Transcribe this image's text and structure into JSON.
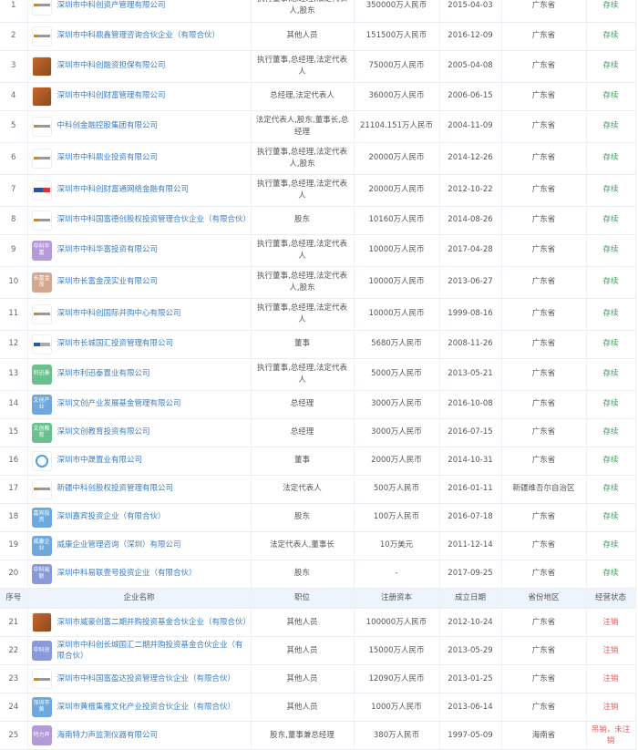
{
  "header": {
    "no": "序号",
    "name": "企业名称",
    "position": "职位",
    "capital": "注册资本",
    "date": "成立日期",
    "province": "省份地区",
    "status": "经营状态"
  },
  "colors": {
    "link": "#3b7dc4",
    "active": "#3c9a5f",
    "cancelled": "#e06060",
    "header_bg": "#eef4fb"
  },
  "table1": [
    {
      "no": "1",
      "logo": "strip",
      "name": "深圳市中科创资产管理有限公司",
      "position": "执行董事,总经理,法定代表人,股东",
      "capital": "350000万人民币",
      "date": "2015-04-03",
      "province": "广东省",
      "status": "存续"
    },
    {
      "no": "2",
      "logo": "strip",
      "name": "深圳市中科鼎鑫管理咨询合伙企业（有限合伙）",
      "position": "其他人员",
      "capital": "151500万人民币",
      "date": "2016-12-09",
      "province": "广东省",
      "status": "存续"
    },
    {
      "no": "3",
      "logo": "orange",
      "name": "深圳市中科创融资担保有限公司",
      "position": "执行董事,总经理,法定代表人",
      "capital": "75000万人民币",
      "date": "2005-04-08",
      "province": "广东省",
      "status": "存续"
    },
    {
      "no": "4",
      "logo": "orange",
      "name": "深圳市中科创财富管理有限公司",
      "position": "总经理,法定代表人",
      "capital": "36000万人民币",
      "date": "2006-06-15",
      "province": "广东省",
      "status": "存续"
    },
    {
      "no": "5",
      "logo": "strip",
      "name": "中科创金融控股集团有限公司",
      "position": "法定代表人,股东,董事长,总经理",
      "capital": "21104.151万人民币",
      "date": "2004-11-09",
      "province": "广东省",
      "status": "存续"
    },
    {
      "no": "6",
      "logo": "strip",
      "name": "深圳市中科鼎业投资有限公司",
      "position": "执行董事,总经理,法定代表人,股东",
      "capital": "20000万人民币",
      "date": "2014-12-26",
      "province": "广东省",
      "status": "存续"
    },
    {
      "no": "7",
      "logo": "flag",
      "name": "深圳市中科创财富通网络金融有限公司",
      "position": "执行董事,总经理,法定代表人",
      "capital": "20000万人民币",
      "date": "2012-10-22",
      "province": "广东省",
      "status": "存续"
    },
    {
      "no": "8",
      "logo": "strip",
      "name": "深圳市中科国富德创股权投资管理合伙企业（有限合伙）",
      "position": "股东",
      "capital": "10160万人民币",
      "date": "2014-08-26",
      "province": "广东省",
      "status": "存续"
    },
    {
      "no": "9",
      "logo": "text",
      "logo_text": "中科华富",
      "logo_color": "#b49ad8",
      "name": "深圳市中科华富投资有限公司",
      "position": "执行董事,总经理,法定代表人",
      "capital": "10000万人民币",
      "date": "2017-04-28",
      "province": "广东省",
      "status": "存续"
    },
    {
      "no": "10",
      "logo": "text",
      "logo_text": "长富金茂",
      "logo_color": "#d4a890",
      "name": "深圳市长富金茂实业有限公司",
      "position": "执行董事,总经理,法定代表人,股东",
      "capital": "10000万人民币",
      "date": "2013-06-27",
      "province": "广东省",
      "status": "存续"
    },
    {
      "no": "11",
      "logo": "strip",
      "name": "深圳市中科创国际并购中心有限公司",
      "position": "执行董事,总经理,法定代表人",
      "capital": "10000万人民币",
      "date": "1999-08-16",
      "province": "广东省",
      "status": "存续"
    },
    {
      "no": "12",
      "logo": "mini",
      "name": "深圳市长城国汇投资管理有限公司",
      "position": "董事",
      "capital": "5680万人民币",
      "date": "2008-11-26",
      "province": "广东省",
      "status": "存续"
    },
    {
      "no": "13",
      "logo": "text",
      "logo_text": "利迅泰",
      "logo_color": "#6cc08e",
      "name": "深圳市利迅泰置业有限公司",
      "position": "执行董事,总经理,法定代表人",
      "capital": "5000万人民币",
      "date": "2013-05-21",
      "province": "广东省",
      "status": "存续"
    },
    {
      "no": "14",
      "logo": "text",
      "logo_text": "文创产业",
      "logo_color": "#6fa8dc",
      "name": "深圳文创产业发展基金管理有限公司",
      "position": "总经理",
      "capital": "3000万人民币",
      "date": "2016-10-08",
      "province": "广东省",
      "status": "存续"
    },
    {
      "no": "15",
      "logo": "text",
      "logo_text": "文创教育",
      "logo_color": "#6cc08e",
      "name": "深圳文创教育投资有限公司",
      "position": "总经理",
      "capital": "3000万人民币",
      "date": "2016-07-15",
      "province": "广东省",
      "status": "存续"
    },
    {
      "no": "16",
      "logo": "house",
      "name": "深圳市中晟置业有限公司",
      "position": "董事",
      "capital": "2000万人民币",
      "date": "2014-10-31",
      "province": "广东省",
      "status": "存续"
    },
    {
      "no": "17",
      "logo": "strip",
      "name": "新疆中科创股权投资管理有限公司",
      "position": "法定代表人",
      "capital": "500万人民币",
      "date": "2016-01-11",
      "province": "新疆维吾尔自治区",
      "status": "存续"
    },
    {
      "no": "18",
      "logo": "text",
      "logo_text": "嘉宾投资",
      "logo_color": "#6fa8dc",
      "name": "深圳嘉宾投资企业（有限合伙）",
      "position": "股东",
      "capital": "100万人民币",
      "date": "2016-07-18",
      "province": "广东省",
      "status": "存续"
    },
    {
      "no": "19",
      "logo": "text",
      "logo_text": "威康企业",
      "logo_color": "#6fa8dc",
      "name": "威康企业管理咨询（深圳）有限公司",
      "position": "法定代表人,董事长",
      "capital": "10万美元",
      "date": "2011-12-14",
      "province": "广东省",
      "status": "存续"
    },
    {
      "no": "20",
      "logo": "text",
      "logo_text": "中科易联",
      "logo_color": "#8a9ad8",
      "name": "深圳中科易联壹号投资企业（有限合伙）",
      "position": "股东",
      "capital": "-",
      "date": "2017-09-25",
      "province": "广东省",
      "status": "存续"
    }
  ],
  "table2": [
    {
      "no": "21",
      "logo": "orange",
      "name": "深圳市威豪创富二期并购投资基金合伙企业（有限合伙）",
      "position": "其他人员",
      "capital": "100000万人民币",
      "date": "2012-10-24",
      "province": "广东省",
      "status": "注销"
    },
    {
      "no": "22",
      "logo": "text",
      "logo_text": "中科创",
      "logo_color": "#8a9ad8",
      "name": "深圳市中科创长城国汇二期并购投资基金合伙企业（有限合伙）",
      "position": "其他人员",
      "capital": "15000万人民币",
      "date": "2013-05-29",
      "province": "广东省",
      "status": "注销"
    },
    {
      "no": "23",
      "logo": "strip",
      "name": "深圳市中科国富盈达投资管理合伙企业（有限合伙）",
      "position": "其他人员",
      "capital": "12090万人民币",
      "date": "2013-01-25",
      "province": "广东省",
      "status": "注销"
    },
    {
      "no": "24",
      "logo": "text",
      "logo_text": "深圳市黄",
      "logo_color": "#6fa8dc",
      "name": "深圳市黄檀集雅文化产业投资合伙企业（有限合伙）",
      "position": "其他人员",
      "capital": "1000万人民币",
      "date": "2013-06-14",
      "province": "广东省",
      "status": "注销"
    },
    {
      "no": "25",
      "logo": "text",
      "logo_text": "特力声",
      "logo_color": "#b49ad8",
      "name": "海南特力声监测仪器有限公司",
      "position": "股东,董事兼总经理",
      "capital": "380万人民币",
      "date": "1997-05-09",
      "province": "海南省",
      "status": "吊销，未注销"
    }
  ]
}
